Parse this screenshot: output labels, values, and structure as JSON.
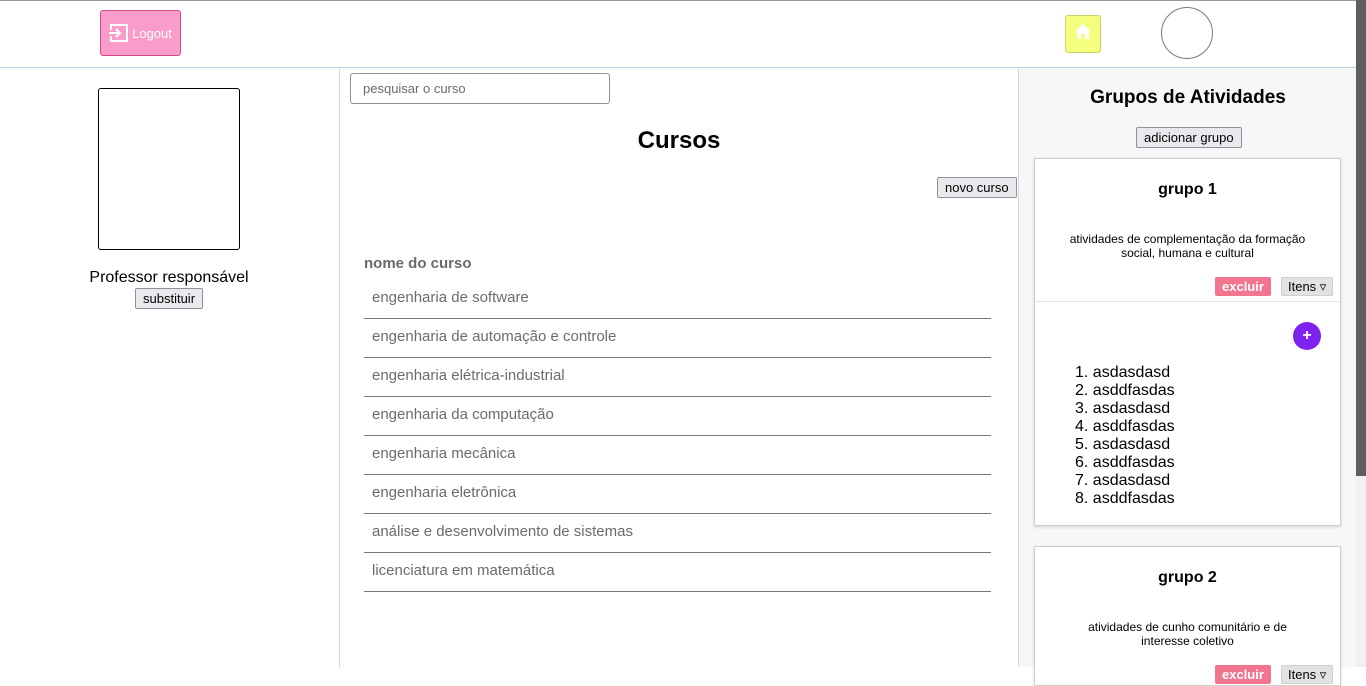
{
  "header": {
    "logout_label": "Logout"
  },
  "left": {
    "professor_label": "Professor responsável",
    "replace_button": "substituir"
  },
  "main": {
    "search_placeholder": "pesquisar o curso",
    "title": "Cursos",
    "new_course_button": "novo curso",
    "column_header": "nome do curso",
    "courses": [
      "engenharia de software",
      "engenharia de automação e controle",
      "engenharia elétrica-industrial",
      "engenharia da computação",
      "engenharia mecânica",
      "engenharia eletrônica",
      "análise e desenvolvimento de sistemas",
      "licenciatura em matemática"
    ]
  },
  "right": {
    "title": "Grupos de Atividades",
    "add_group_button": "adicionar grupo",
    "groups": [
      {
        "name": "grupo 1",
        "description": "atividades de complementação da formação social, humana e cultural",
        "delete_label": "excluir",
        "items_label": "Itens ▿",
        "add_item_glyph": "+",
        "items": [
          "asdasdasd",
          "asddfasdas",
          "asdasdasd",
          "asddfasdas",
          "asdasdasd",
          "asddfasdas",
          "asdasdasd",
          "asddfasdas"
        ]
      },
      {
        "name": "grupo 2",
        "description": "atividades de cunho comunitário e de interesse coletivo",
        "delete_label": "excluir",
        "items_label": "Itens ▿"
      }
    ]
  },
  "colors": {
    "logout_bg": "#f99cc9",
    "home_bg": "#f4ff80",
    "delete_bg": "#f2758f",
    "add_item_bg": "#7e22f0"
  }
}
